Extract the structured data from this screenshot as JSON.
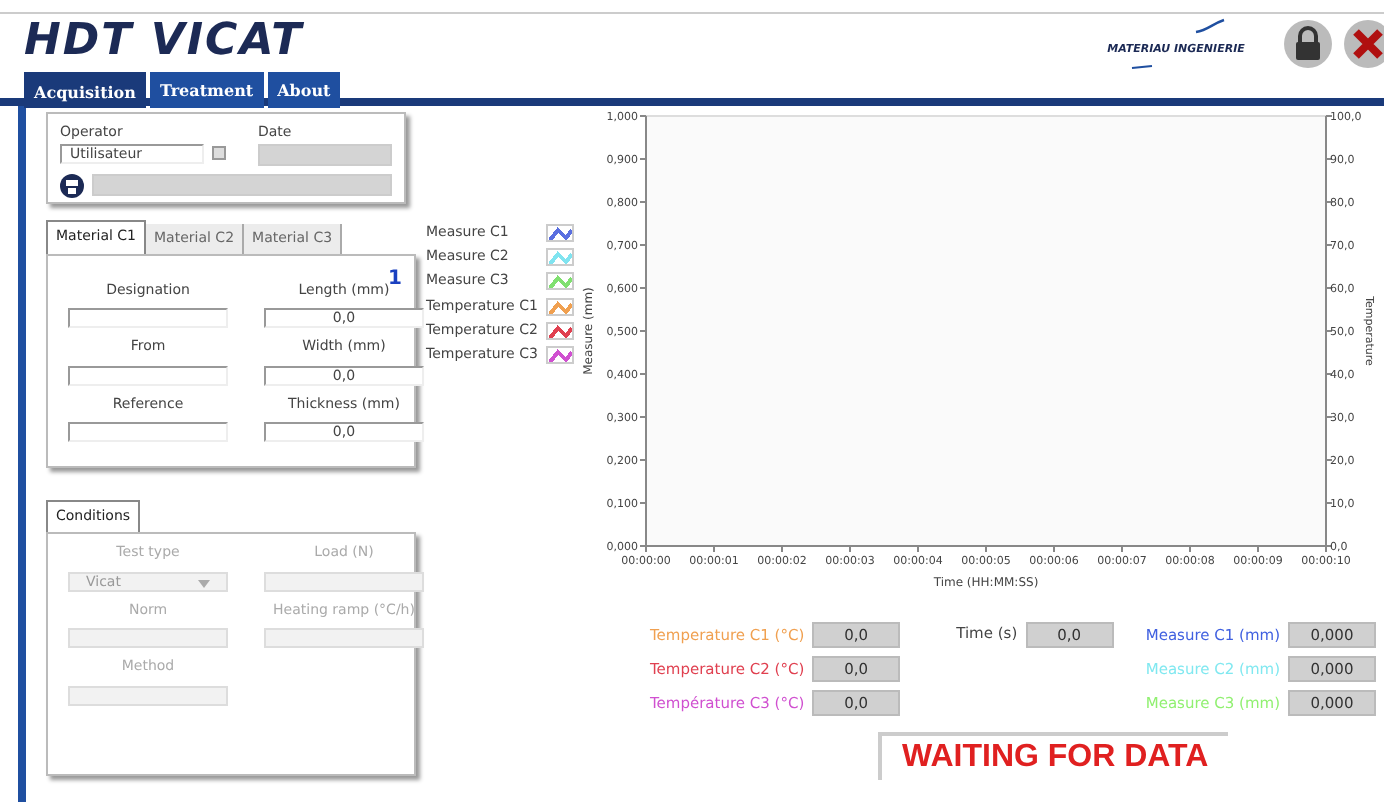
{
  "header": {
    "title": "HDT VICAT",
    "logo_text": "MATERIAU INGENIERIE"
  },
  "tabs": [
    {
      "label": "Acquisition",
      "selected": true
    },
    {
      "label": "Treatment",
      "selected": false
    },
    {
      "label": "About",
      "selected": false
    }
  ],
  "operator_panel": {
    "operator_label": "Operator",
    "operator_value": "Utilisateur",
    "date_label": "Date"
  },
  "material": {
    "tabs": [
      {
        "label": "Material C1",
        "selected": true
      },
      {
        "label": "Material C2",
        "selected": false
      },
      {
        "label": "Material C3",
        "selected": false
      }
    ],
    "index": "1",
    "fields": [
      {
        "label": "Designation"
      },
      {
        "label": "Length (mm)",
        "value": "0,0"
      },
      {
        "label": "From"
      },
      {
        "label": "Width (mm)",
        "value": "0,0"
      },
      {
        "label": "Reference"
      },
      {
        "label": "Thickness (mm)",
        "value": "0,0"
      }
    ]
  },
  "conditions": {
    "tabs": [
      {
        "label": "Conditions",
        "selected": true
      }
    ],
    "fields": [
      {
        "label": "Test type",
        "value": "Vicat",
        "kind": "select",
        "disabled": true
      },
      {
        "label": "Load (N)",
        "kind": "text",
        "disabled": true
      },
      {
        "label": "Norm",
        "kind": "text",
        "disabled": true
      },
      {
        "label": "Heating ramp (°C/h)",
        "kind": "text",
        "disabled": true
      },
      {
        "label": "Method",
        "kind": "text",
        "disabled": true
      }
    ]
  },
  "legend": [
    {
      "name": "Measure C1",
      "color": "#5a6fe0"
    },
    {
      "name": "Measure C2",
      "color": "#80e4f0"
    },
    {
      "name": "Measure C3",
      "color": "#80e070"
    },
    {
      "name": "Temperature C1",
      "color": "#f0a050"
    },
    {
      "name": "Temperature C2",
      "color": "#e04050"
    },
    {
      "name": "Temperature C3",
      "color": "#d050d0"
    }
  ],
  "chart": {
    "chart_data": {
      "type": "line",
      "xlabel": "Time (HH:MM:SS)",
      "ylabel": "Measure (mm)",
      "xlim": [
        0,
        10
      ],
      "ylim": [
        0,
        1
      ],
      "xticks": [
        {
          "value": 0,
          "label": "00:00:00"
        },
        {
          "value": 1,
          "label": "00:00:01"
        },
        {
          "value": 2,
          "label": "00:00:02"
        },
        {
          "value": 3,
          "label": "00:00:03"
        },
        {
          "value": 4,
          "label": "00:00:04"
        },
        {
          "value": 5,
          "label": "00:00:05"
        },
        {
          "value": 6,
          "label": "00:00:06"
        },
        {
          "value": 7,
          "label": "00:00:07"
        },
        {
          "value": 8,
          "label": "00:00:08"
        },
        {
          "value": 9,
          "label": "00:00:09"
        },
        {
          "value": 10,
          "label": "00:00:10"
        }
      ],
      "yticks": [
        {
          "value": 0,
          "label": "0,000"
        },
        {
          "value": 0.1,
          "label": "0,100"
        },
        {
          "value": 0.2,
          "label": "0,200"
        },
        {
          "value": 0.3,
          "label": "0,300"
        },
        {
          "value": 0.4,
          "label": "0,400"
        },
        {
          "value": 0.5,
          "label": "0,500"
        },
        {
          "value": 0.6,
          "label": "0,600"
        },
        {
          "value": 0.7,
          "label": "0,700"
        },
        {
          "value": 0.8,
          "label": "0,800"
        },
        {
          "value": 0.9,
          "label": "0,900"
        },
        {
          "value": 1,
          "label": "1,000"
        }
      ]
    },
    "right_axis": {
      "label": "Temperature",
      "ticks": [
        "100,0",
        "90,0",
        "80,0",
        "70,0",
        "60,0",
        "50,0",
        "40,0",
        "30,0",
        "20,0",
        "10,0",
        "0,0"
      ]
    }
  },
  "readouts_left": [
    {
      "label": "Temperature C1 (°C)",
      "value": "0,0",
      "color": "#f0a050"
    },
    {
      "label": "Temperature C2 (°C)",
      "value": "0,0",
      "color": "#e04050"
    },
    {
      "label": "Température C3 (°C)",
      "value": "0,0",
      "color": "#d050d0"
    }
  ],
  "time_readout": {
    "label": "Time (s)",
    "value": "0,0"
  },
  "readouts_right": [
    {
      "label": "Measure C1 (mm)",
      "value": "0,000",
      "color": "#4060e0"
    },
    {
      "label": "Measure C2 (mm)",
      "value": "0,000",
      "color": "#80e8f0"
    },
    {
      "label": "Measure C3 (mm)",
      "value": "0,000",
      "color": "#90f070"
    }
  ],
  "status": "WAITING FOR DATA"
}
